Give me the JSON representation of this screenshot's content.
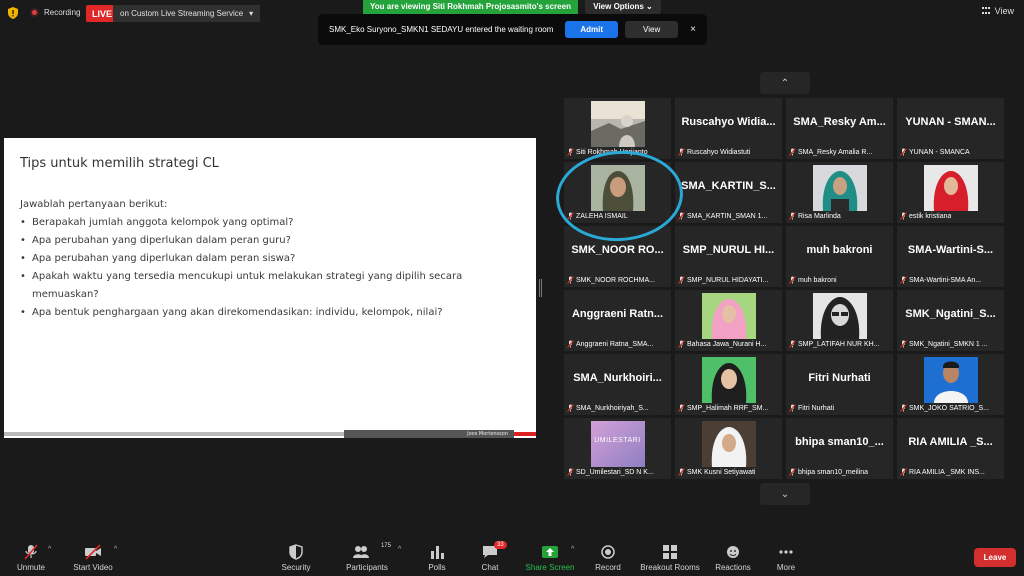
{
  "topbar": {
    "recording_label": "Recording",
    "live_badge": "LIVE",
    "live_service": "on Custom Live Streaming Service",
    "viewing_banner": "You are viewing Siti Rokhmah Projosasmito's screen",
    "view_options": "View Options",
    "view_label": "View"
  },
  "notification": {
    "message": "SMK_Eko Suryono_SMKN1 SEDAYU entered the waiting room",
    "admit_label": "Admit",
    "view_label": "View",
    "close_glyph": "×"
  },
  "slide": {
    "title": "Tips untuk memilih strategi CL",
    "intro": "Jawablah pertanyaan berikut:",
    "bullets": [
      "Berapakah jumlah anggota kelompok yang optimal?",
      "Apa perubahan yang diperlukan dalam peran guru?",
      "Apa perubahan yang diperlukan dalam peran siswa?",
      "Apakah waktu yang tersedia mencukupi untuk melakukan strategi yang dipilih secara memuaskan?",
      "Apa bentuk penghargaan yang akan direkomendasikan: individu, kelompok, nilai?"
    ],
    "footer_author": "Joos Mortensson"
  },
  "gallery": {
    "up_glyph": "⌃",
    "down_glyph": "⌄",
    "tiles": [
      {
        "big": "",
        "caption": "Siti Rokhmah Harjianto",
        "photo": "landscape"
      },
      {
        "big": "Ruscahyo Widia...",
        "caption": "Ruscahyo Widiastuti"
      },
      {
        "big": "SMA_Resky Am...",
        "caption": "SMA_Resky Amalia R..."
      },
      {
        "big": "YUNAN - SMAN...",
        "caption": "YUNAN - SMANCA"
      },
      {
        "big": "",
        "caption": "ZALEHA ISMAIL",
        "photo": "hijab-dark"
      },
      {
        "big": "SMA_KARTIN_S...",
        "caption": "SMA_KARTIN_SMAN 1..."
      },
      {
        "big": "",
        "caption": "Risa Marlinda",
        "photo": "hijab-teal"
      },
      {
        "big": "",
        "caption": "estik kristiana",
        "photo": "hijab-red"
      },
      {
        "big": "SMK_NOOR RO...",
        "caption": "SMK_NOOR ROCHMA..."
      },
      {
        "big": "SMP_NURUL HI...",
        "caption": "SMP_NURUL HIDAYATI..."
      },
      {
        "big": "muh bakroni",
        "caption": "muh bakroni"
      },
      {
        "big": "SMA-Wartini-S...",
        "caption": "SMA-Wartini-SMA An..."
      },
      {
        "big": "Anggraeni Ratn...",
        "caption": "Anggraeni Ratna_SMA..."
      },
      {
        "big": "",
        "caption": "Bahasa Jawa_Nurani H...",
        "photo": "hijab-pink"
      },
      {
        "big": "",
        "caption": "SMP_LATIFAH NUR KH...",
        "photo": "bw"
      },
      {
        "big": "SMK_Ngatini_S...",
        "caption": "SMK_Ngatini_SMKN 1 ..."
      },
      {
        "big": "SMA_Nurkhoiri...",
        "caption": "SMA_Nurkhoiriyah_S..."
      },
      {
        "big": "",
        "caption": "SMP_Halimah RRF_SM...",
        "photo": "hijab-black"
      },
      {
        "big": "Fitri Nurhati",
        "caption": "Fitri Nurhati"
      },
      {
        "big": "",
        "caption": "SMK_JOKO SATRIO_S...",
        "photo": "man-blue"
      },
      {
        "big": "",
        "caption": "SD_Umilestari_SD N K...",
        "photo": "umilestari",
        "photo_text": "UMILESTARI"
      },
      {
        "big": "",
        "caption": "SMK Kusni Setiyawati",
        "photo": "hijab-white"
      },
      {
        "big": "bhipa sman10_...",
        "caption": "bhipa sman10_meilina"
      },
      {
        "big": "RIA AMILIA _S...",
        "caption": "RIA AMILIA _SMK INS..."
      }
    ]
  },
  "toolbar": {
    "unmute": "Unmute",
    "start_video": "Start Video",
    "security": "Security",
    "participants": "Participants",
    "participants_count": "175",
    "polls": "Polls",
    "chat": "Chat",
    "chat_badge": "33",
    "share_screen": "Share Screen",
    "record": "Record",
    "breakout_rooms": "Breakout Rooms",
    "reactions": "Reactions",
    "more": "More",
    "leave": "Leave",
    "caret_glyph": "^"
  },
  "colors": {
    "share_green": "#23a33a",
    "admit_blue": "#1a73e8",
    "leave_red": "#d32f2f",
    "annotation_circle": "#2aa8d6"
  }
}
